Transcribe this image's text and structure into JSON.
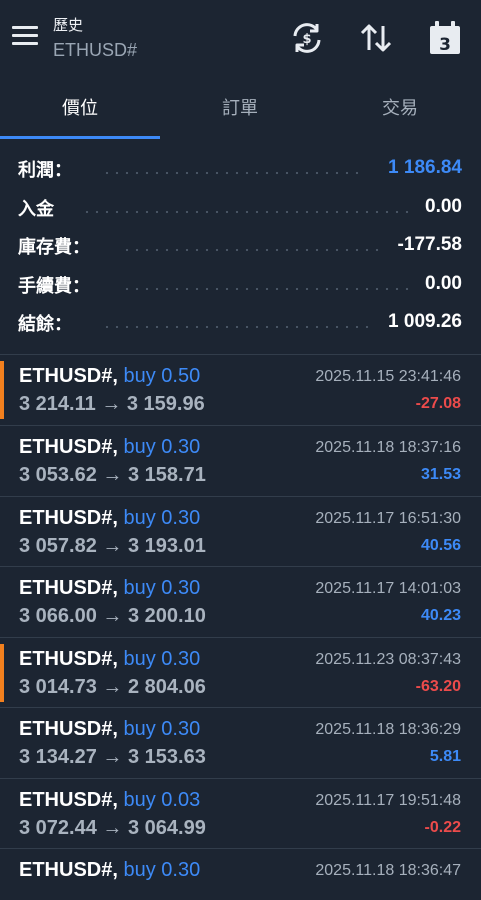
{
  "header": {
    "title": "歷史",
    "symbol": "ETHUSD#",
    "calendar_day": "3",
    "icons": [
      "menu-icon",
      "sync-icon",
      "sort-icon",
      "calendar-icon"
    ]
  },
  "tabs": [
    {
      "label": "價位",
      "active": true
    },
    {
      "label": "訂單",
      "active": false
    },
    {
      "label": "交易",
      "active": false
    }
  ],
  "summary": [
    {
      "label": "利潤：",
      "value": "1 186.84"
    },
    {
      "label": "入金",
      "value": "0.00"
    },
    {
      "label": "庫存費：",
      "value": "-177.58"
    },
    {
      "label": "手續費：",
      "value": "0.00"
    },
    {
      "label": "結餘：",
      "value": "1 009.26"
    }
  ],
  "trades": [
    {
      "symbol": "ETHUSD#,",
      "side": "buy 0.50",
      "open": "3 214.11",
      "arrow": "→",
      "close": "3 159.96",
      "time": "2025.11.15 23:41:46",
      "profit": "-27.08",
      "flagged": true
    },
    {
      "symbol": "ETHUSD#,",
      "side": "buy 0.30",
      "open": "3 053.62",
      "arrow": "→",
      "close": "3 158.71",
      "time": "2025.11.18 18:37:16",
      "profit": "31.53",
      "flagged": false
    },
    {
      "symbol": "ETHUSD#,",
      "side": "buy 0.30",
      "open": "3 057.82",
      "arrow": "→",
      "close": "3 193.01",
      "time": "2025.11.17 16:51:30",
      "profit": "40.56",
      "flagged": false
    },
    {
      "symbol": "ETHUSD#,",
      "side": "buy 0.30",
      "open": "3 066.00",
      "arrow": "→",
      "close": "3 200.10",
      "time": "2025.11.17 14:01:03",
      "profit": "40.23",
      "flagged": false
    },
    {
      "symbol": "ETHUSD#,",
      "side": "buy 0.30",
      "open": "3 014.73",
      "arrow": "→",
      "close": "2 804.06",
      "time": "2025.11.23 08:37:43",
      "profit": "-63.20",
      "flagged": true
    },
    {
      "symbol": "ETHUSD#,",
      "side": "buy 0.30",
      "open": "3 134.27",
      "arrow": "→",
      "close": "3 153.63",
      "time": "2025.11.18 18:36:29",
      "profit": "5.81",
      "flagged": false
    },
    {
      "symbol": "ETHUSD#,",
      "side": "buy 0.03",
      "open": "3 072.44",
      "arrow": "→",
      "close": "3 064.99",
      "time": "2025.11.17 19:51:48",
      "profit": "-0.22",
      "flagged": false
    },
    {
      "symbol": "ETHUSD#,",
      "side": "buy 0.30",
      "open": "",
      "arrow": "",
      "close": "",
      "time": "2025.11.18 18:36:47",
      "profit": "",
      "flagged": false
    }
  ],
  "colors": {
    "background": "#1c2532",
    "accent": "#3d8af7",
    "negative": "#ec4b4b",
    "marker": "#f2801e"
  }
}
